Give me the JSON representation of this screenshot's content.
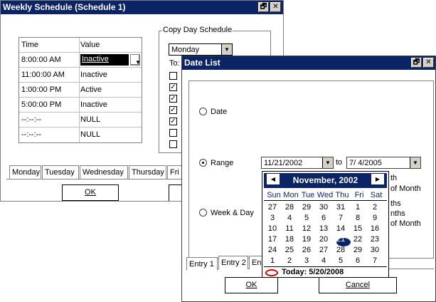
{
  "weekly_window": {
    "title": "Weekly Schedule (Schedule 1)",
    "restore_glyph": "🗗",
    "close_glyph": "✕",
    "table": {
      "headers": [
        "Time",
        "Value"
      ],
      "rows": [
        {
          "time": "8:00:00 AM",
          "value": "Inactive"
        },
        {
          "time": "11:00:00 AM",
          "value": "Inactive"
        },
        {
          "time": "1:00:00 PM",
          "value": "Active"
        },
        {
          "time": "5:00:00 PM",
          "value": "Inactive"
        },
        {
          "time": "--:--:--",
          "value": "NULL"
        },
        {
          "time": "--:--:--",
          "value": "NULL"
        }
      ]
    },
    "copy_group": {
      "label": "Copy Day Schedule",
      "day_select": "Monday",
      "to_label": "To:",
      "checks": [
        false,
        true,
        true,
        true,
        true,
        false,
        false
      ]
    },
    "tabs": [
      "Monday",
      "Tuesday",
      "Wednesday",
      "Thursday",
      "Fri"
    ],
    "ok_label": "OK"
  },
  "date_window": {
    "title": "Date List",
    "restore_glyph": "🗗",
    "close_glyph": "✕",
    "options": {
      "date": "Date",
      "range": "Range",
      "week_day": "Week & Day"
    },
    "range_from": "11/21/2002",
    "range_to_label": "to",
    "range_to": "7/ 4/2005",
    "side_text": [
      "th",
      "of Month",
      "ths",
      "nths",
      "of Month"
    ],
    "tabs": [
      "Entry 1",
      "Entry 2",
      "En"
    ],
    "ok_label": "OK",
    "cancel_label": "Cancel"
  },
  "calendar": {
    "month_label": "November, 2002",
    "prev_glyph": "◀",
    "next_glyph": "▶",
    "dow": [
      "Sun",
      "Mon",
      "Tue",
      "Wed",
      "Thu",
      "Fri",
      "Sat"
    ],
    "weeks": [
      [
        "27",
        "28",
        "29",
        "30",
        "31",
        "1",
        "2"
      ],
      [
        "3",
        "4",
        "5",
        "6",
        "7",
        "8",
        "9"
      ],
      [
        "10",
        "11",
        "12",
        "13",
        "14",
        "15",
        "16"
      ],
      [
        "17",
        "18",
        "19",
        "20",
        "21",
        "22",
        "23"
      ],
      [
        "24",
        "25",
        "26",
        "27",
        "28",
        "29",
        "30"
      ],
      [
        "1",
        "2",
        "3",
        "4",
        "5",
        "6",
        "7"
      ]
    ],
    "selected": "21",
    "today_label": "Today: 5/20/2008"
  }
}
